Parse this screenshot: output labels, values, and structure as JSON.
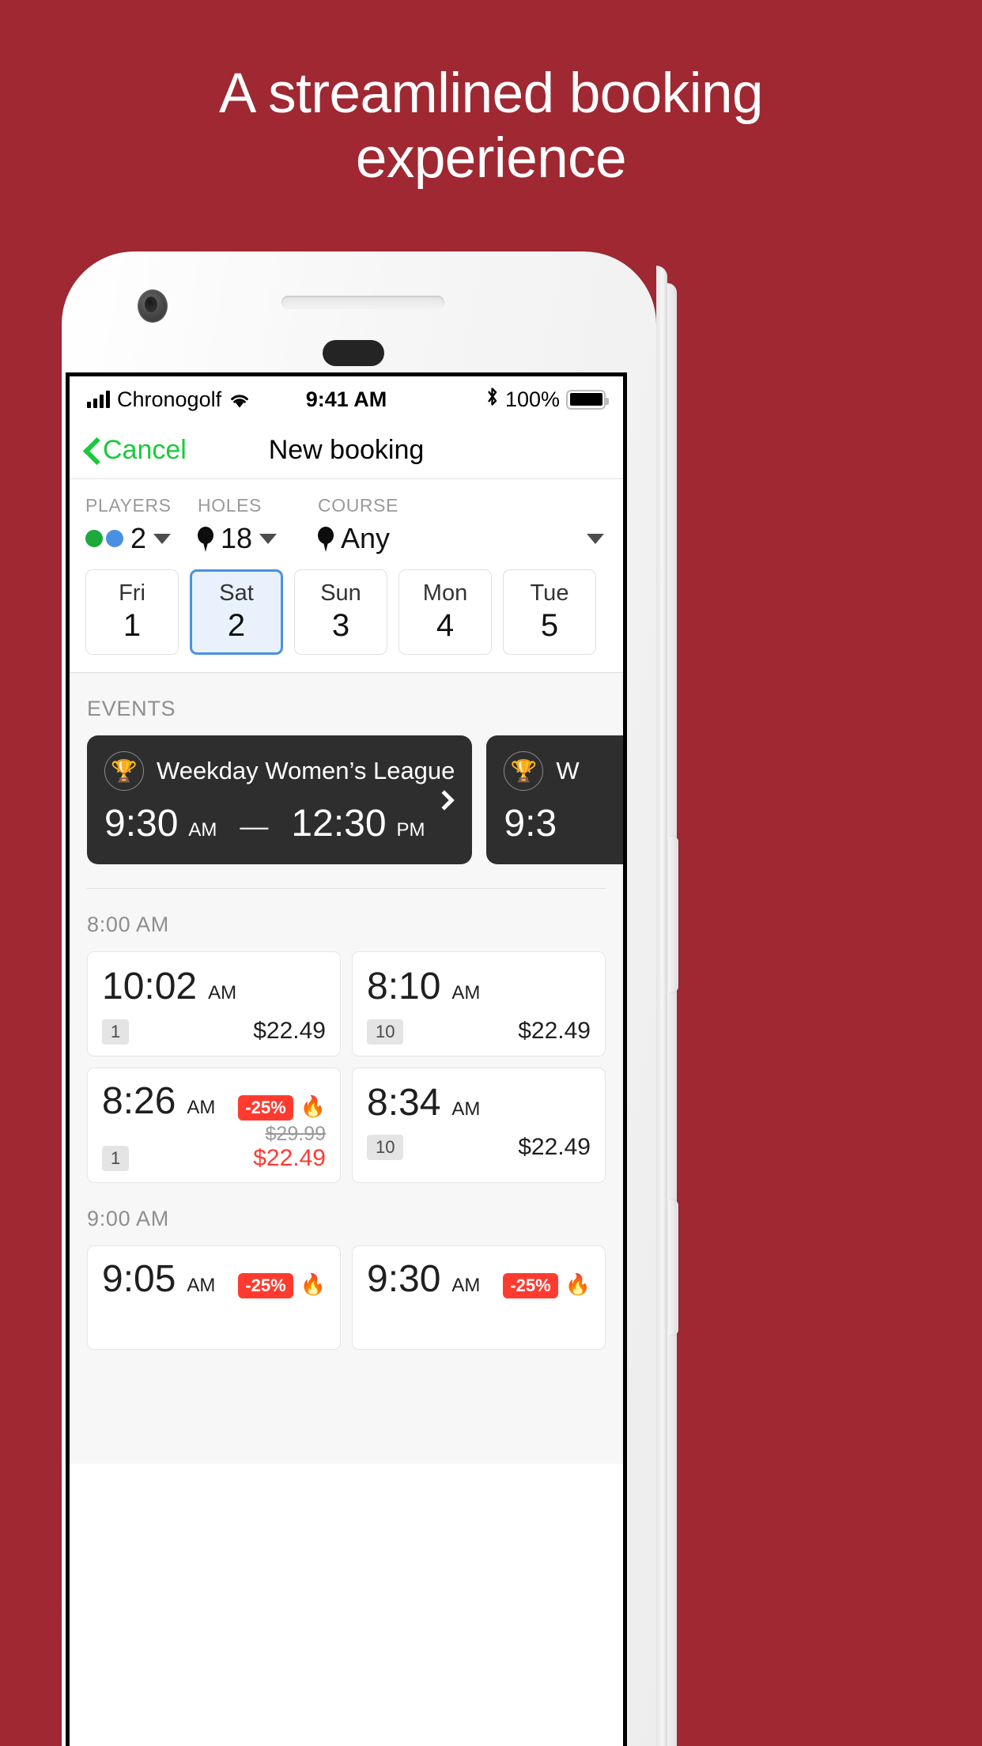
{
  "marketing": {
    "headline": "A streamlined booking experience",
    "background_color": "#9F2832"
  },
  "status_bar": {
    "carrier": "Chronogolf",
    "time": "9:41 AM",
    "battery_percent": "100%",
    "signal_icon": "signal-bars-icon",
    "wifi_icon": "wifi-icon",
    "bluetooth_icon": "bluetooth-icon",
    "battery_icon": "battery-full-icon"
  },
  "nav": {
    "back_label": "Cancel",
    "back_icon": "chevron-left-icon",
    "title": "New booking",
    "accent_color": "#1ACA3C"
  },
  "filters": [
    {
      "label": "PLAYERS",
      "value": "2",
      "icon": "player-dots-icon",
      "caret": "chevron-down-icon"
    },
    {
      "label": "HOLES",
      "value": "18",
      "icon": "golf-tee-icon",
      "caret": "chevron-down-icon"
    },
    {
      "label": "COURSE",
      "value": "Any",
      "icon": "golf-tee-icon",
      "caret": "chevron-down-icon"
    }
  ],
  "dates": [
    {
      "dow": "Fri",
      "day": "1",
      "selected": false
    },
    {
      "dow": "Sat",
      "day": "2",
      "selected": true
    },
    {
      "dow": "Sun",
      "day": "3",
      "selected": false
    },
    {
      "dow": "Mon",
      "day": "4",
      "selected": false
    },
    {
      "dow": "Tue",
      "day": "5",
      "selected": false
    }
  ],
  "selected_date_color": "#4A90E2",
  "events": {
    "section_label": "EVENTS",
    "cards": [
      {
        "icon": "trophy-icon",
        "title": "Weekday Women’s League",
        "start_time": "9:30",
        "start_meridiem": "AM",
        "separator": "—",
        "end_time": "12:30",
        "end_meridiem": "PM",
        "chevron": "chevron-right-icon"
      },
      {
        "icon": "trophy-icon",
        "title": "W",
        "start_time": "9:3",
        "start_meridiem": "",
        "separator": "",
        "end_time": "",
        "end_meridiem": "",
        "chevron": ""
      }
    ]
  },
  "tee_time_groups": [
    {
      "label": "8:00 AM",
      "slots": [
        {
          "time": "10:02",
          "meridiem": "AM",
          "capacity": "1",
          "price": "$22.49",
          "discount": null,
          "old_price": null,
          "flame": false
        },
        {
          "time": "8:10",
          "meridiem": "AM",
          "capacity": "10",
          "price": "$22.49",
          "discount": null,
          "old_price": null,
          "flame": false
        },
        {
          "time": "8:26",
          "meridiem": "AM",
          "capacity": "1",
          "price": "$22.49",
          "discount": "-25%",
          "old_price": "$29.99",
          "flame": true
        },
        {
          "time": "8:34",
          "meridiem": "AM",
          "capacity": "10",
          "price": "$22.49",
          "discount": null,
          "old_price": null,
          "flame": false
        }
      ]
    },
    {
      "label": "9:00 AM",
      "slots": [
        {
          "time": "9:05",
          "meridiem": "AM",
          "capacity": "",
          "price": "",
          "discount": "-25%",
          "old_price": null,
          "flame": true
        },
        {
          "time": "9:30",
          "meridiem": "AM",
          "capacity": "",
          "price": "",
          "discount": "-25%",
          "old_price": null,
          "flame": true
        }
      ]
    }
  ],
  "colors": {
    "discount_red": "#FF3B30",
    "event_card_bg": "#2E2E2E",
    "content_bg": "#F7F7F7"
  }
}
